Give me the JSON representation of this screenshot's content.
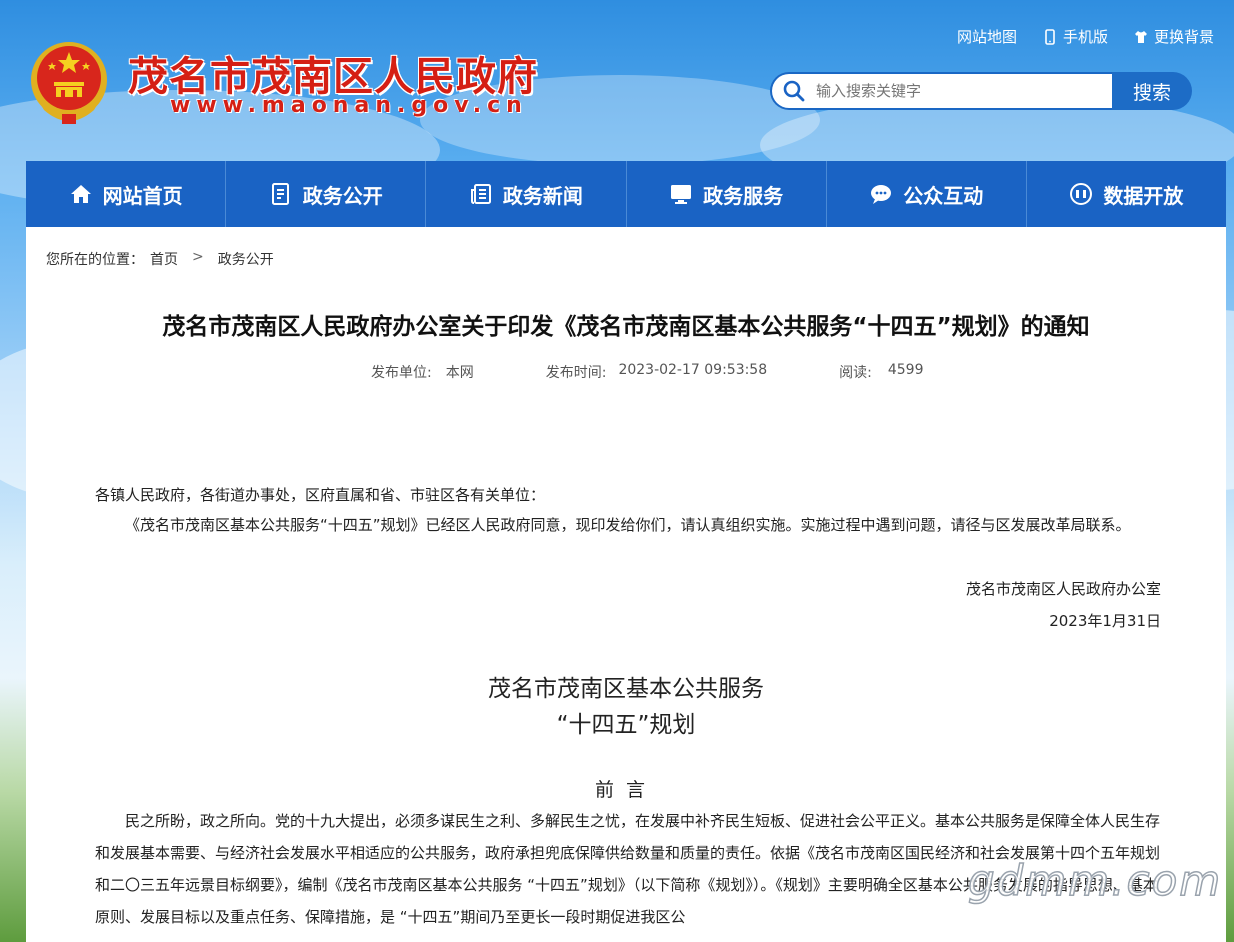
{
  "header": {
    "site_name": "茂名市茂南区人民政府",
    "site_url": "www.maonan.gov.cn",
    "top_links": [
      {
        "label": "网站地图",
        "icon": ""
      },
      {
        "label": "手机版",
        "icon": "mobile-icon"
      },
      {
        "label": "更换背景",
        "icon": "shirt-icon"
      }
    ],
    "search": {
      "placeholder": "输入搜索关键字",
      "button_label": "搜索"
    }
  },
  "nav": {
    "items": [
      {
        "label": "网站首页",
        "icon": "home-icon"
      },
      {
        "label": "政务公开",
        "icon": "document-icon"
      },
      {
        "label": "政务新闻",
        "icon": "news-icon"
      },
      {
        "label": "政务服务",
        "icon": "monitor-icon"
      },
      {
        "label": "公众互动",
        "icon": "chat-icon"
      },
      {
        "label": "数据开放",
        "icon": "data-icon"
      }
    ]
  },
  "breadcrumb": {
    "prefix": "您所在的位置：",
    "items": [
      "首页",
      "政务公开"
    ]
  },
  "article": {
    "title": "茂名市茂南区人民政府办公室关于印发《茂名市茂南区基本公共服务“十四五”规划》的通知",
    "meta": {
      "publisher_label": "发布单位:",
      "publisher": "本网",
      "time_label": "发布时间:",
      "time": "2023-02-17 09:53:58",
      "views_label": "阅读:",
      "views": "4599"
    },
    "salutation": "各镇人民政府，各街道办事处，区府直属和省、市驻区各有关单位：",
    "notice": "《茂名市茂南区基本公共服务“十四五”规划》已经区人民政府同意，现印发给你们，请认真组织实施。实施过程中遇到问题，请径与区发展改革局联系。",
    "signature": "茂名市茂南区人民政府办公室",
    "date": "2023年1月31日",
    "doc_title_line1": "茂名市茂南区基本公共服务",
    "doc_title_line2": "“十四五”规划",
    "preface_heading": "前言",
    "preface_text": "民之所盼，政之所向。党的十九大提出，必须多谋民生之利、多解民生之忧，在发展中补齐民生短板、促进社会公平正义。基本公共服务是保障全体人民生存和发展基本需要、与经济社会发展水平相适应的公共服务，政府承担兜底保障供给数量和质量的责任。依据《茂名市茂南区国民经济和社会发展第十四个五年规划和二〇三五年远景目标纲要》，编制《茂名市茂南区基本公共服务 “十四五”规划》（以下简称《规划》）。《规划》主要明确全区基本公共服务发展的指导思想、基本原则、发展目标以及重点任务、保障措施，是 “十四五”期间乃至更长一段时期促进我区公"
  },
  "watermark": "gdmm.com",
  "colors": {
    "brand_red": "#d51f14",
    "nav_blue": "#1a63c4"
  }
}
